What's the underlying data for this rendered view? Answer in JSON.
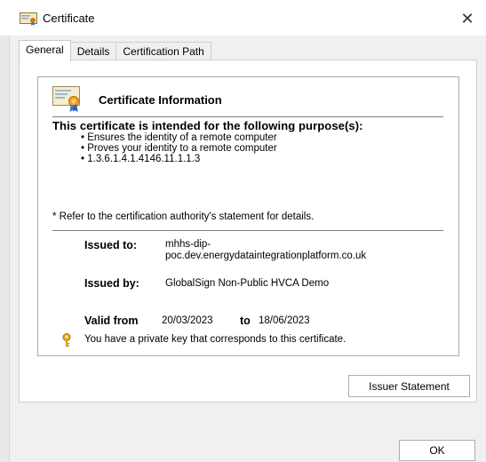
{
  "window": {
    "title": "Certificate",
    "close_glyph": "✕"
  },
  "tabs": [
    {
      "label": "General",
      "active": true
    },
    {
      "label": "Details",
      "active": false
    },
    {
      "label": "Certification Path",
      "active": false
    }
  ],
  "general": {
    "heading": "Certificate Information",
    "purpose_title": "This certificate is intended for the following purpose(s):",
    "purposes": [
      "Ensures the identity of a remote computer",
      "Proves your identity to a remote computer",
      "1.3.6.1.4.1.4146.11.1.1.3"
    ],
    "refer_note": "* Refer to the certification authority's statement for details.",
    "issued_to_label": "Issued to:",
    "issued_to_value": "mhhs-dip-poc.dev.energydataintegrationplatform.co.uk",
    "issued_to_line1": "mhhs-dip-",
    "issued_to_line2": "poc.dev.energydataintegrationplatform.co.uk",
    "issued_by_label": "Issued by:",
    "issued_by_value": "GlobalSign Non-Public HVCA Demo",
    "valid_from_label": "Valid from",
    "valid_from_value": "20/03/2023",
    "valid_to_label": "to",
    "valid_to_value": "18/06/2023",
    "private_key_note": "You have a private key that corresponds to this certificate."
  },
  "buttons": {
    "issuer_statement": "Issuer Statement",
    "ok": "OK"
  },
  "icons": {
    "title": "certificate-icon",
    "heading": "certificate-icon",
    "key": "key-icon",
    "close": "close-icon"
  },
  "colors": {
    "key_gold": "#d4a017",
    "cert_ribbon": "#e07b00",
    "cert_blue": "#3a78c4"
  }
}
